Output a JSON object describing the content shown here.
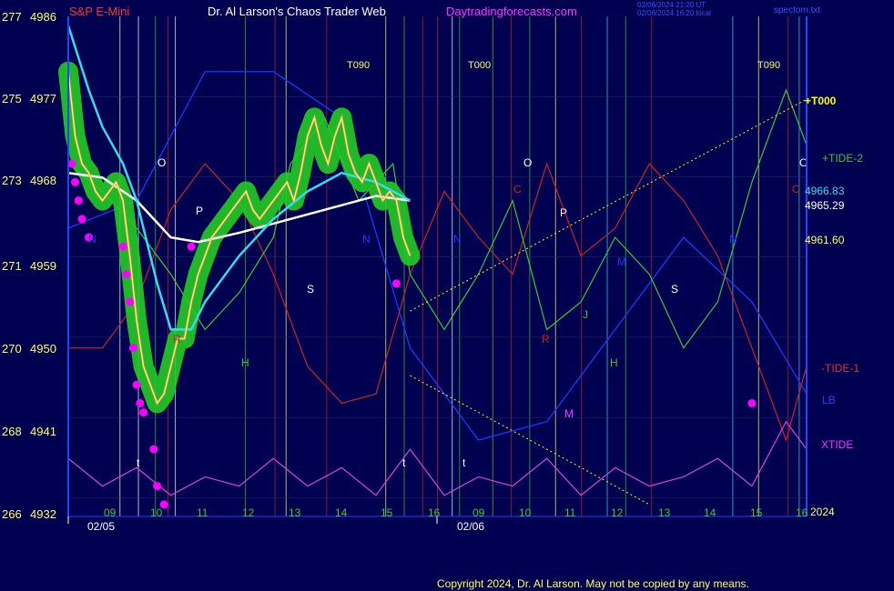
{
  "header": {
    "instrument": "S&P E-Mini",
    "title": "Dr. Al Larson's Chaos Trader Web",
    "site": "Daytradingforecasts.com",
    "stamp1": "02/06/2024 21:20 UT",
    "stamp2": "02/06/2024 16:20 local",
    "file": "spectom.txt"
  },
  "footer": {
    "copyright": "Copyright 2024, Dr. Al Larson. May not be copied by any means."
  },
  "colors": {
    "background": "#000050",
    "price": "#ffff00",
    "tide2": "#33cc33",
    "tide1": "#cc2222",
    "lb": "#1a3aff",
    "xtide": "#e040e0",
    "cyan_ma": "#33ddee",
    "white_ma": "#ffffff",
    "green_halo": "#22cc22",
    "magenta_dot": "#ff00ff"
  },
  "chart_data": {
    "type": "line",
    "title": "S&P E-Mini",
    "y_left_labels": [
      "277",
      "275",
      "273",
      "271",
      "270",
      "268",
      "266"
    ],
    "y_right_labels": [
      "4986",
      "4977",
      "4968",
      "4959",
      "4950",
      "4941",
      "4932"
    ],
    "ylim": [
      4932,
      4986
    ],
    "x_hour_ticks": [
      "09",
      "10",
      "11",
      "12",
      "13",
      "14",
      "15",
      "16",
      "09",
      "10",
      "11",
      "12",
      "13",
      "14",
      "15",
      "16"
    ],
    "x_date_labels": [
      "02/05",
      "02/06"
    ],
    "year_label": "2024",
    "top_markers": [
      "T090",
      "T000",
      "T090"
    ],
    "series_labels": [
      "+T000",
      "+TIDE-2",
      "-TIDE-1",
      "LB",
      "XTIDE"
    ],
    "value_labels": [
      "4966.83",
      "4965.29",
      "4961.60"
    ],
    "cycle_letters": [
      "O",
      "P",
      "N",
      "R",
      "S",
      "H",
      "t",
      "N",
      "N",
      "O",
      "C",
      "P",
      "R",
      "M",
      "H",
      "J",
      "M",
      "S",
      "N",
      "O",
      "C",
      "t",
      "t"
    ],
    "price_series": {
      "name": "S&P E-Mini",
      "x": [
        0,
        2,
        4,
        6,
        8,
        10,
        12,
        14,
        16,
        18,
        20,
        22,
        24,
        26,
        28,
        30,
        32,
        34,
        36,
        38,
        40,
        42,
        44,
        46,
        48,
        50,
        52,
        54,
        56,
        58,
        60,
        62,
        64,
        66,
        68,
        70,
        72,
        74,
        76,
        78,
        80,
        82,
        84,
        86,
        88,
        90,
        92,
        94,
        96,
        98,
        100
      ],
      "y": [
        4980,
        4973,
        4970,
        4969,
        4967,
        4966,
        4967,
        4968,
        4966,
        4960,
        4953,
        4948,
        4946,
        4944,
        4945,
        4948,
        4951,
        4951,
        4955,
        4958,
        4960,
        4962,
        4963,
        4964,
        4965,
        4966,
        4967,
        4965,
        4964,
        4965,
        4966,
        4967,
        4968,
        4966,
        4969,
        4973,
        4975,
        4972,
        4970,
        4973,
        4975,
        4971,
        4969,
        4968,
        4970,
        4968,
        4966,
        4967,
        4966,
        4962,
        4960
      ]
    },
    "white_ma_series": {
      "name": "white average",
      "x": [
        0,
        10,
        20,
        30,
        38,
        50,
        60,
        70,
        80,
        90,
        100
      ],
      "y": [
        4969,
        4968.5,
        4966,
        4962,
        4961.5,
        4962.5,
        4963.5,
        4964.5,
        4965.5,
        4966.5,
        4966
      ]
    },
    "cyan_ma_series": {
      "name": "cyan average",
      "x": [
        0,
        6,
        10,
        16,
        20,
        26,
        30,
        36,
        40,
        50,
        60,
        70,
        80,
        90,
        100
      ],
      "y": [
        4985,
        4978,
        4974,
        4970,
        4966,
        4957,
        4952,
        4952,
        4955,
        4960,
        4964,
        4967,
        4969,
        4968,
        4966
      ]
    },
    "tide2_series": {
      "name": "+TIDE-2",
      "x": [
        0,
        10,
        20,
        30,
        40,
        50,
        60,
        65,
        75,
        85,
        95,
        100,
        110,
        120,
        130,
        140,
        150,
        160,
        170,
        180,
        190,
        200,
        210,
        216
      ],
      "y": [
        4970,
        4967,
        4963,
        4958,
        4952,
        4956,
        4962,
        4970,
        4975,
        4966,
        4970,
        4958,
        4952,
        4958,
        4966,
        4952,
        4955,
        4962,
        4958,
        4950,
        4955,
        4968,
        4978,
        4972
      ]
    },
    "tide1_series": {
      "name": "-TIDE-1",
      "x": [
        0,
        10,
        20,
        30,
        40,
        50,
        60,
        70,
        80,
        90,
        100,
        110,
        120,
        130,
        140,
        150,
        160,
        170,
        180,
        190,
        200,
        210,
        216
      ],
      "y": [
        4950,
        4950,
        4955,
        4965,
        4970,
        4966,
        4958,
        4948,
        4944,
        4945,
        4958,
        4967,
        4962,
        4958,
        4970,
        4960,
        4963,
        4970,
        4966,
        4960,
        4950,
        4940,
        4948
      ]
    },
    "lb_series": {
      "name": "LB",
      "x": [
        0,
        20,
        40,
        60,
        80,
        100,
        120,
        140,
        160,
        180,
        200,
        216
      ],
      "y": [
        4963,
        4966,
        4980,
        4980,
        4975,
        4950,
        4940,
        4942,
        4952,
        4962,
        4955,
        4945
      ]
    },
    "xtide_series": {
      "name": "XTIDE",
      "x": [
        0,
        10,
        20,
        30,
        40,
        50,
        60,
        70,
        80,
        90,
        100,
        110,
        120,
        130,
        140,
        150,
        160,
        170,
        180,
        190,
        200,
        210,
        216
      ],
      "y": [
        4938,
        4935,
        4937,
        4934,
        4936,
        4935,
        4938,
        4935,
        4937,
        4934,
        4939,
        4934,
        4936,
        4935,
        4938,
        4934,
        4937,
        4935,
        4936,
        4938,
        4935,
        4942,
        4939
      ]
    }
  }
}
